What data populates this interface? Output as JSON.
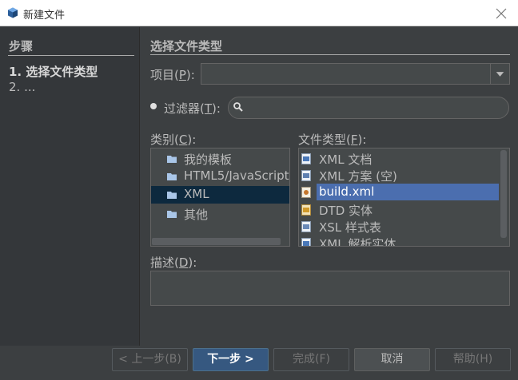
{
  "window": {
    "title": "新建文件",
    "close_icon": "close-icon",
    "app_icon": "netbeans-cube-icon"
  },
  "steps": {
    "heading": "步骤",
    "items": [
      "1.  选择文件类型",
      "2.  ..."
    ]
  },
  "main": {
    "title": "选择文件类型",
    "project": {
      "label": "项目(",
      "mnemonic": "P",
      "label_end": "):",
      "value": ""
    },
    "filter": {
      "label": "过滤器(",
      "mnemonic": "T",
      "label_end": "):",
      "value": ""
    },
    "categories": {
      "label": "类别(",
      "mnemonic": "C",
      "label_end": "):",
      "items": [
        {
          "label": "我的模板",
          "selected": false
        },
        {
          "label": "HTML5/JavaScript",
          "selected": false
        },
        {
          "label": "XML",
          "selected": true
        },
        {
          "label": "其他",
          "selected": false
        }
      ]
    },
    "file_types": {
      "label": "文件类型(",
      "mnemonic": "F",
      "label_end": "):",
      "items": [
        {
          "label": "XML 文档",
          "icon": "xml-document-icon",
          "selected": false
        },
        {
          "label": "XML 方案 (空)",
          "icon": "xml-schema-icon",
          "selected": false
        },
        {
          "label": "build.xml",
          "icon": "ant-build-icon",
          "selected": true
        },
        {
          "label": "DTD 实体",
          "icon": "dtd-icon",
          "selected": false
        },
        {
          "label": "XSL 样式表",
          "icon": "xsl-icon",
          "selected": false
        },
        {
          "label": "XML 解析实体",
          "icon": "xml-entity-icon",
          "selected": false
        }
      ]
    },
    "description": {
      "label": "描述(",
      "mnemonic": "D",
      "label_end": "):",
      "value": ""
    }
  },
  "buttons": {
    "back": "< 上一步(B)",
    "next": "下一步 >",
    "finish": "完成(F)",
    "cancel": "取消",
    "help": "帮助(H)"
  },
  "colors": {
    "background": "#3c3f41",
    "selection": "#4b6eaf",
    "category_selection": "#0d293e",
    "default_button": "#365880"
  }
}
